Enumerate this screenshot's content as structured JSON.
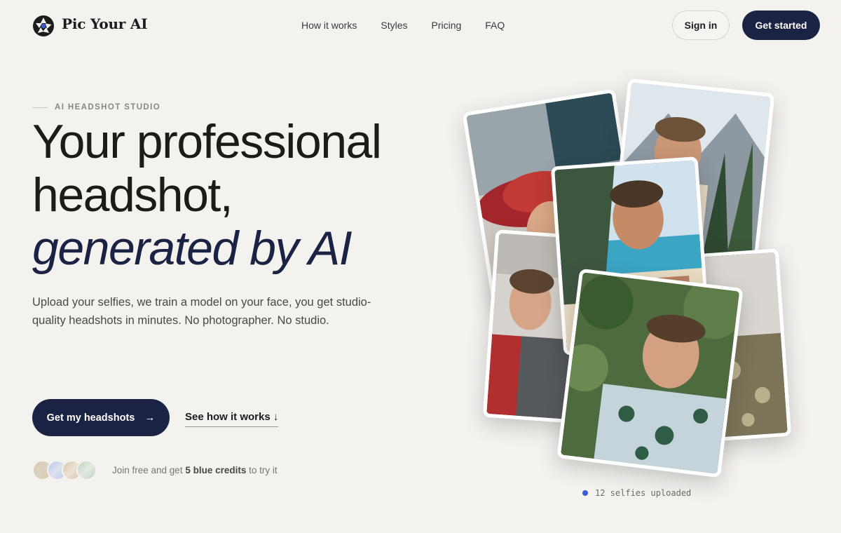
{
  "brand": {
    "name": "Pic Your AI",
    "logo_icon": "camera-aperture-icon"
  },
  "nav": {
    "links": [
      "How it works",
      "Styles",
      "Pricing",
      "FAQ"
    ],
    "sign_in": "Sign in",
    "get_started": "Get started"
  },
  "hero": {
    "eyebrow": "AI HEADSHOT STUDIO",
    "headline_line1": "Your professional",
    "headline_line2": "headshot,",
    "headline_accent": "generated by AI",
    "subtext": "Upload your selfies, we train a model on your face, you get studio-quality headshots in minutes. No photographer. No studio.",
    "primary_cta": "Get my headshots",
    "primary_cta_icon": "arrow-right-icon",
    "secondary_cta": "See how it works ↓",
    "credits_prefix": "Join free and get",
    "credits_highlight": "5 blue credits",
    "credits_suffix": "to try it"
  },
  "collage": {
    "status_text": "12 selfies uploaded"
  },
  "colors": {
    "background": "#f4f2ef",
    "navy": "#1b2344",
    "status_dot": "#3b5bd6"
  }
}
